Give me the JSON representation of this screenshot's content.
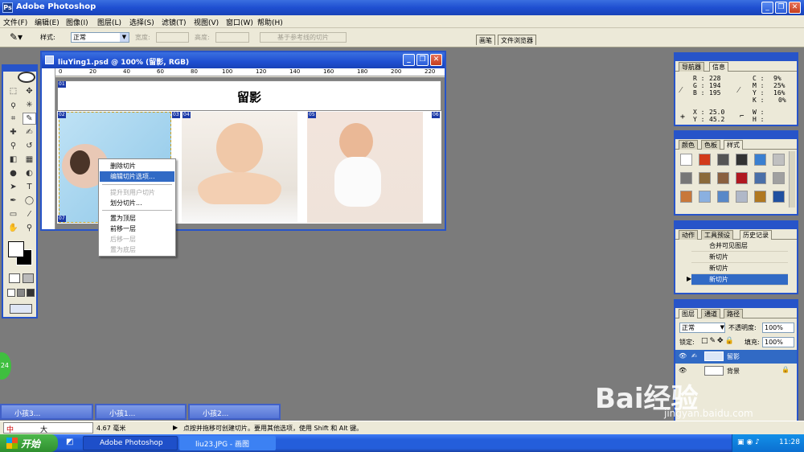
{
  "app": {
    "title": "Adobe Photoshop",
    "icon": "photoshop-icon"
  },
  "menu": [
    "文件(F)",
    "编辑(E)",
    "图像(I)",
    "图层(L)",
    "选择(S)",
    "滤镜(T)",
    "视图(V)",
    "窗口(W)",
    "帮助(H)"
  ],
  "options": {
    "style_label": "样式:",
    "style_value": "正常",
    "width_label": "宽度:",
    "height_label": "高度:",
    "guides_button": "基于参考线的切片"
  },
  "palette_well": [
    "画笔",
    "文件浏览器"
  ],
  "document": {
    "title": "liuYing1.psd @ 100% (留影, RGB)",
    "heading": "留影",
    "ruler_marks": [
      "0",
      "20",
      "40",
      "60",
      "80",
      "100",
      "120",
      "140",
      "160",
      "180",
      "200",
      "220"
    ],
    "slice_tags": [
      "01",
      "02",
      "03",
      "04",
      "05",
      "06",
      "07"
    ]
  },
  "context_menu": {
    "items": [
      {
        "label": "删除切片",
        "state": "normal"
      },
      {
        "label": "编辑切片选项...",
        "state": "highlighted"
      },
      {
        "label": "提升到用户切片",
        "state": "disabled"
      },
      {
        "label": "划分切片...",
        "state": "normal"
      },
      {
        "label": "置为顶层",
        "state": "normal"
      },
      {
        "label": "前移一层",
        "state": "normal"
      },
      {
        "label": "后移一层",
        "state": "disabled"
      },
      {
        "label": "置为底层",
        "state": "disabled"
      }
    ]
  },
  "info_panel": {
    "tabs": [
      "导航器",
      "信息"
    ],
    "r": "R :",
    "r_val": "228",
    "g": "G :",
    "g_val": "194",
    "b": "B :",
    "b_val": "195",
    "c": "C :",
    "c_val": "9%",
    "m": "M :",
    "m_val": "25%",
    "y": "Y :",
    "y_val": "16%",
    "k": "K :",
    "k_val": "0%",
    "x": "X :",
    "x_val": "25.0",
    "yc": "Y :",
    "yc_val": "45.2",
    "w": "W :",
    "h": "H :"
  },
  "styles_panel": {
    "tabs": [
      "颜色",
      "色板",
      "样式"
    ],
    "swatches": [
      "#ffffff",
      "#d23a1a",
      "#555555",
      "#333333",
      "#3a7fd0",
      "#c0c0c0",
      "#777777",
      "#8a6a3a",
      "#8a6040",
      "#b01820",
      "#4a6fa8",
      "#a0a0a0",
      "#c8783a",
      "#8ab0e0",
      "#5888c8",
      "#b0b8c8",
      "#b07820",
      "#2050a0"
    ]
  },
  "history_panel": {
    "tabs": [
      "动作",
      "工具预设",
      "历史记录"
    ],
    "items": [
      "合并可见图层",
      "新切片",
      "新切片",
      "新切片"
    ]
  },
  "layers_panel": {
    "tabs": [
      "图层",
      "通道",
      "路径"
    ],
    "blend_mode": "正常",
    "opacity_label": "不透明度:",
    "opacity_value": "100%",
    "lock_label": "锁定:",
    "fill_label": "填充:",
    "fill_value": "100%",
    "layers": [
      {
        "name": "留影",
        "selected": true
      },
      {
        "name": "背景",
        "selected": false
      }
    ]
  },
  "minimized_docs": [
    "小孩3...",
    "小孩1...",
    "小孩2..."
  ],
  "status": {
    "ime": "中",
    "ime_extra": "大",
    "measure": "4.67 毫米",
    "hint": "点按并拖移可创建切片。要用其他选项，使用 Shift 和 Alt 键。"
  },
  "taskbar": {
    "start": "开始",
    "items": [
      "Adobe Photoshop",
      "liu23.JPG - 画图"
    ],
    "time": "11:28"
  },
  "badge": "24",
  "watermark": {
    "text": "Bai经验",
    "sub": "jingyan.baidu.com"
  },
  "colors": {
    "titlebar": "#1f4fd1",
    "selection": "#316ac5",
    "workspace": "#7b7b7b",
    "panel": "#ece9d8"
  }
}
